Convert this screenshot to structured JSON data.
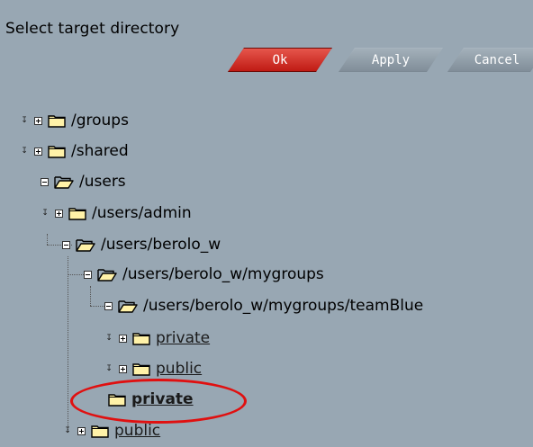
{
  "dialog": {
    "title": "Select target directory"
  },
  "buttons": {
    "ok": "Ok",
    "apply": "Apply",
    "cancel": "Cancel"
  },
  "tree": [
    {
      "label": "/groups"
    },
    {
      "label": "/shared"
    },
    {
      "label": "/users"
    },
    {
      "label": "/users/admin"
    },
    {
      "label": "/users/berolo_w"
    },
    {
      "label": "/users/berolo_w/mygroups"
    },
    {
      "label": "/users/berolo_w/mygroups/teamBlue"
    },
    {
      "label": "private"
    },
    {
      "label": "public"
    },
    {
      "label": "private"
    },
    {
      "label": "public"
    }
  ],
  "colors": {
    "background": "#98a7b3",
    "ok_button": "#c01b14",
    "highlight_circle": "#e01010"
  }
}
